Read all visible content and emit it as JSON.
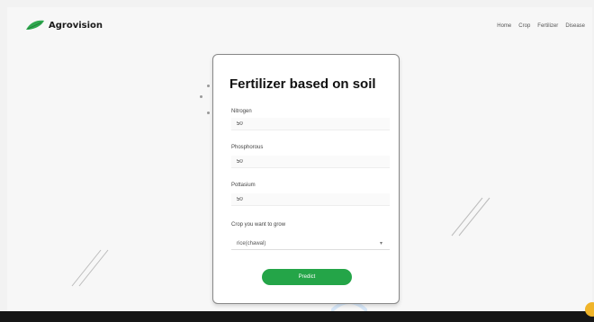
{
  "header": {
    "brand": "Agrovision",
    "nav": [
      "Home",
      "Crop",
      "Fertilizer",
      "Disease"
    ]
  },
  "form": {
    "title": "Fertilizer based on soil",
    "fields": [
      {
        "label": "Nitrogen",
        "value": "50"
      },
      {
        "label": "Phosphorous",
        "value": "50"
      },
      {
        "label": "Pottasium",
        "value": "50"
      }
    ],
    "crop_label": "Crop you want to grow",
    "crop_selected": "rice(chawal)",
    "submit_label": "Predict"
  },
  "colors": {
    "accent": "#24a548",
    "background": "#f7f7f7"
  }
}
